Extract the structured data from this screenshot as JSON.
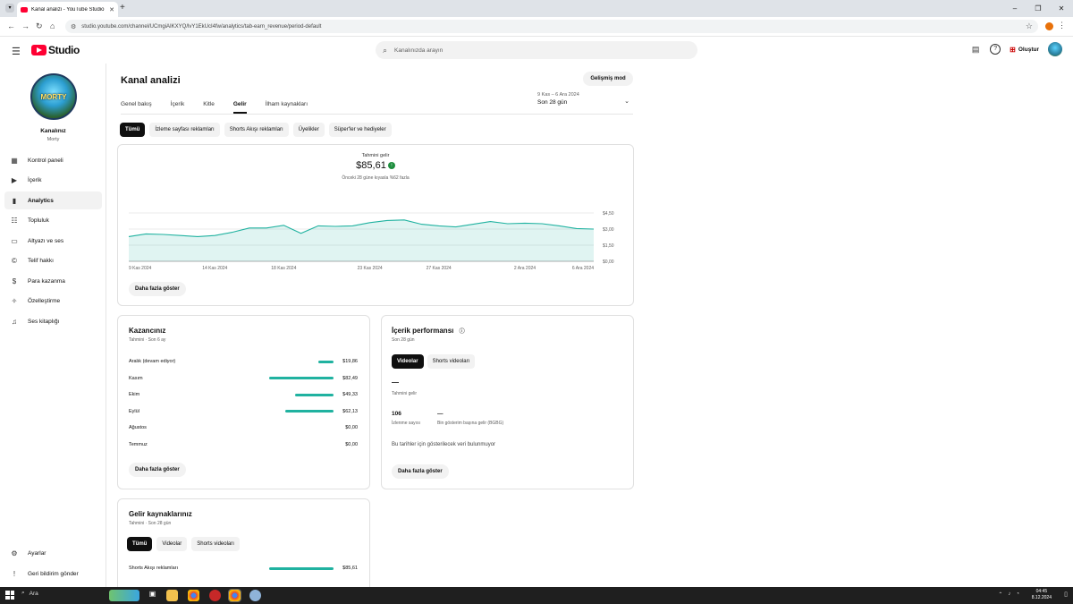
{
  "browser": {
    "tab_title": "Kanal analizi - YouTube Studio",
    "url": "studio.youtube.com/channel/UCmgiAIKXYQ/lvY1EkUcI4fw/analytics/tab-earn_revenue/period-default"
  },
  "header": {
    "logo_text": "Studio",
    "search_placeholder": "Kanalınızda arayın",
    "create_label": "Oluştur"
  },
  "sidebar": {
    "channel_label": "Kanalınız",
    "channel_name": "Morty",
    "avatar_text": "MORTY",
    "items": [
      {
        "label": "Kontrol paneli",
        "icon": "dashboard-icon"
      },
      {
        "label": "İçerik",
        "icon": "content-icon"
      },
      {
        "label": "Analytics",
        "icon": "analytics-icon"
      },
      {
        "label": "Topluluk",
        "icon": "community-icon"
      },
      {
        "label": "Altyazı ve ses",
        "icon": "subtitles-icon"
      },
      {
        "label": "Telif hakkı",
        "icon": "copyright-icon"
      },
      {
        "label": "Para kazanma",
        "icon": "monetization-icon"
      },
      {
        "label": "Özelleştirme",
        "icon": "customization-icon"
      },
      {
        "label": "Ses kitaplığı",
        "icon": "audio-library-icon"
      }
    ],
    "bottom_items": [
      {
        "label": "Ayarlar",
        "icon": "gear-icon"
      },
      {
        "label": "Geri bildirim gönder",
        "icon": "feedback-icon"
      }
    ]
  },
  "main": {
    "title": "Kanal analizi",
    "advanced_mode": "Gelişmiş mod",
    "tabs": [
      "Genel bakış",
      "İçerik",
      "Kitle",
      "Gelir",
      "İlham kaynakları"
    ],
    "active_tab": "Gelir",
    "date_range_small": "9 Kas – 6 Ara 2024",
    "date_range_label": "Son 28 gün",
    "chips": [
      "Tümü",
      "İzleme sayfası reklamları",
      "Shorts Akışı reklamları",
      "Üyelikler",
      "Süper'ler ve hediyeler"
    ],
    "revenue_label": "Tahmini gelir",
    "revenue_value": "$85,61",
    "revenue_compare": "Önceki 28 güne kıyasla %62 fazla",
    "show_more": "Daha fazla göster"
  },
  "chart_data": {
    "type": "area",
    "x": [
      "9 Kas",
      "10 Kas",
      "11 Kas",
      "12 Kas",
      "13 Kas",
      "14 Kas",
      "15 Kas",
      "16 Kas",
      "17 Kas",
      "18 Kas",
      "19 Kas",
      "20 Kas",
      "21 Kas",
      "22 Kas",
      "23 Kas",
      "24 Kas",
      "25 Kas",
      "26 Kas",
      "27 Kas",
      "28 Kas",
      "29 Kas",
      "30 Kas",
      "1 Ara",
      "2 Ara",
      "3 Ara",
      "4 Ara",
      "5 Ara",
      "6 Ara"
    ],
    "values": [
      2.3,
      2.55,
      2.5,
      2.4,
      2.3,
      2.4,
      2.7,
      3.1,
      3.1,
      3.35,
      2.6,
      3.3,
      3.25,
      3.3,
      3.6,
      3.8,
      3.85,
      3.45,
      3.3,
      3.2,
      3.45,
      3.7,
      3.5,
      3.55,
      3.5,
      3.3,
      3.05,
      3.0
    ],
    "x_tick_labels": [
      "9 Kas 2024",
      "14 Kas 2024",
      "18 Kas 2024",
      "23 Kas 2024",
      "27 Kas 2024",
      "2 Ara 2024",
      "6 Ara 2024"
    ],
    "y_tick_labels": [
      "$4,50",
      "$3,00",
      "$1,50",
      "$0,00"
    ],
    "ylim": [
      0,
      4.5
    ],
    "grid": true,
    "color": "#20b2a0"
  },
  "earnings": {
    "title": "Kazancınız",
    "subtitle": "Tahmini · Son 6 ay",
    "rows": [
      {
        "month": "Aralık (devam ediyor)",
        "value": "$19,86",
        "amount": 19.86
      },
      {
        "month": "Kasım",
        "value": "$82,49",
        "amount": 82.49
      },
      {
        "month": "Ekim",
        "value": "$49,33",
        "amount": 49.33
      },
      {
        "month": "Eylül",
        "value": "$62,13",
        "amount": 62.13
      },
      {
        "month": "Ağustos",
        "value": "$0,00",
        "amount": 0
      },
      {
        "month": "Temmuz",
        "value": "$0,00",
        "amount": 0
      }
    ],
    "show_more": "Daha fazla göster"
  },
  "performance": {
    "title": "İçerik performansı",
    "subtitle": "Son 28 gün",
    "chips": [
      "Videolar",
      "Shorts videoları"
    ],
    "dash": "—",
    "rev_label": "Tahmini gelir",
    "views_value": "106",
    "views_label": "İzlenme sayısı",
    "rpm_value": "—",
    "rpm_label": "Bin gösterim başına gelir (BGBG)",
    "empty": "Bu tarihler için gösterilecek veri bulunmuyor",
    "show_more": "Daha fazla göster"
  },
  "sources": {
    "title": "Gelir kaynaklarınız",
    "subtitle": "Tahmini · Son 28 gün",
    "chips": [
      "Tümü",
      "Videolar",
      "Shorts videoları"
    ],
    "row_label": "Shorts Akışı reklamları",
    "row_value": "$85,61",
    "row_amount": 85.61
  },
  "taskbar": {
    "search_label": "Ara",
    "time": "04:45",
    "date": "8.12.2024"
  }
}
